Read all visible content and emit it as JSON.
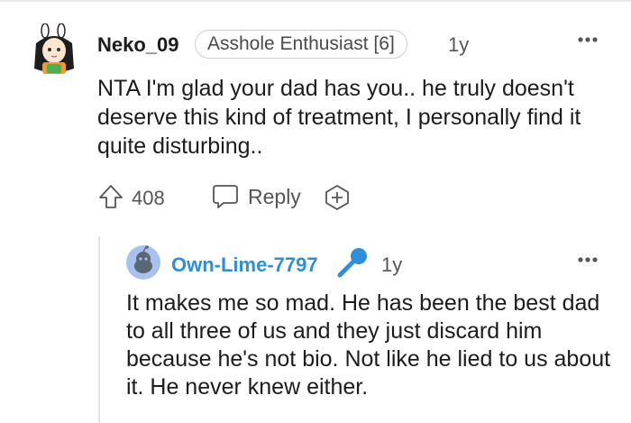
{
  "comment": {
    "username": "Neko_09",
    "flair": "Asshole Enthusiast [6]",
    "age": "1y",
    "avatar_icon": "anime-bunny-avatar-icon",
    "body": "NTA I'm glad your dad has you.. he truly doesn't deserve this kind of treatment, I personally find it quite disturbing..",
    "votes": "408",
    "reply_label": "Reply"
  },
  "reply": {
    "username": "Own-Lime-7797",
    "age": "1y",
    "avatar_icon": "snoo-avatar-icon",
    "op_badge_icon": "microphone-icon",
    "body": "It makes me so mad. He has been the best dad to all three of us and they just discard him because he's not bio. Not like he lied to us about it. He never knew either."
  },
  "colors": {
    "username_op": "#2e8fd8",
    "text": "#1c1c1c",
    "muted": "#555555"
  }
}
